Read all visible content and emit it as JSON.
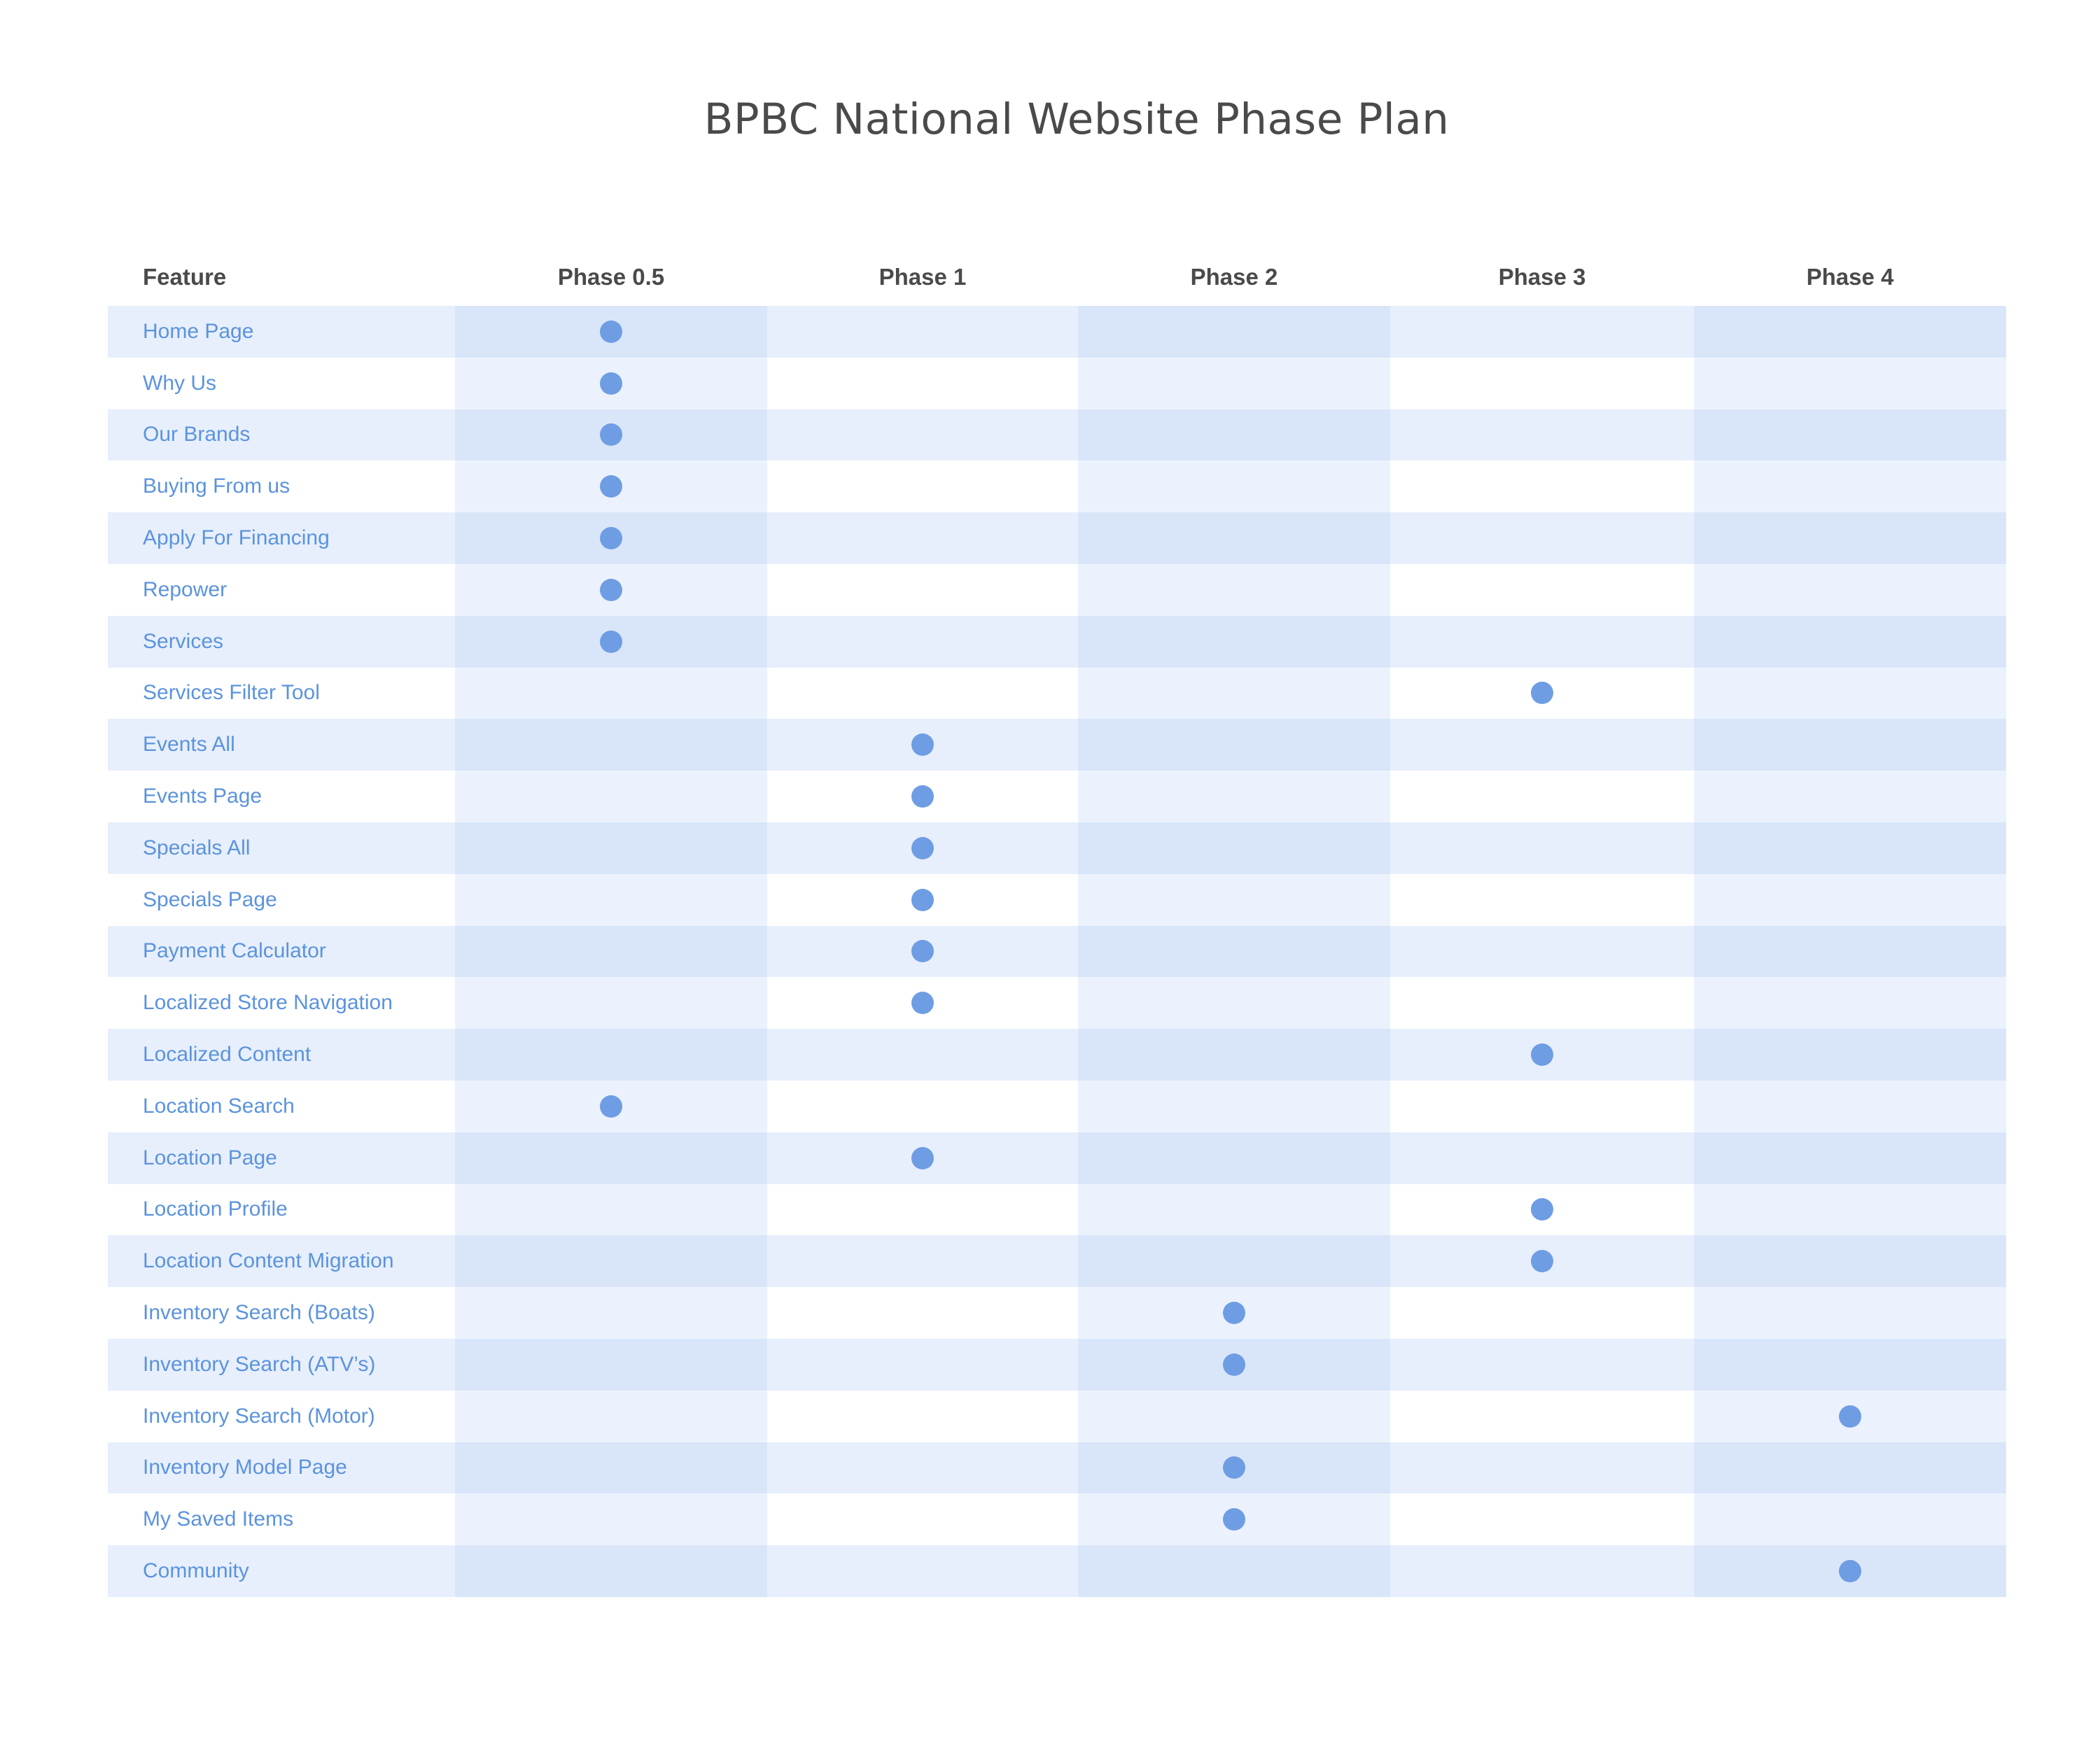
{
  "title": "BPBC National Website Phase Plan",
  "colors": {
    "title": "#4a4a4a",
    "header": "#4a4a4a",
    "feature_text": "#5b93dd",
    "dot": "#6e9de4",
    "band_dark": "#d9e6f9",
    "band_light": "#e7effc",
    "band_dark_alt": "#ebf2fd",
    "row_white": "#ffffff"
  },
  "columns": [
    "Feature",
    "Phase 0.5",
    "Phase 1",
    "Phase 2",
    "Phase 3",
    "Phase 4"
  ],
  "phases": [
    "Phase 0.5",
    "Phase 1",
    "Phase 2",
    "Phase 3",
    "Phase 4"
  ],
  "marker_icon": "filled-circle-icon",
  "rows": [
    {
      "feature": "Home Page",
      "phase": "Phase 0.5"
    },
    {
      "feature": "Why Us",
      "phase": "Phase 0.5"
    },
    {
      "feature": "Our Brands",
      "phase": "Phase 0.5"
    },
    {
      "feature": "Buying From us",
      "phase": "Phase 0.5"
    },
    {
      "feature": "Apply For Financing",
      "phase": "Phase 0.5"
    },
    {
      "feature": "Repower",
      "phase": "Phase 0.5"
    },
    {
      "feature": "Services",
      "phase": "Phase 0.5"
    },
    {
      "feature": "Services Filter Tool",
      "phase": "Phase 3"
    },
    {
      "feature": "Events All",
      "phase": "Phase 1"
    },
    {
      "feature": "Events Page",
      "phase": "Phase 1"
    },
    {
      "feature": "Specials All",
      "phase": "Phase 1"
    },
    {
      "feature": "Specials Page",
      "phase": "Phase 1"
    },
    {
      "feature": "Payment Calculator",
      "phase": "Phase 1"
    },
    {
      "feature": "Localized Store Navigation",
      "phase": "Phase 1"
    },
    {
      "feature": "Localized Content",
      "phase": "Phase 3"
    },
    {
      "feature": "Location Search",
      "phase": "Phase 0.5"
    },
    {
      "feature": "Location Page",
      "phase": "Phase 1"
    },
    {
      "feature": "Location Profile",
      "phase": "Phase 3"
    },
    {
      "feature": "Location Content Migration",
      "phase": "Phase 3"
    },
    {
      "feature": "Inventory Search (Boats)",
      "phase": "Phase 2"
    },
    {
      "feature": "Inventory Search (ATV’s)",
      "phase": "Phase 2"
    },
    {
      "feature": "Inventory Search (Motor)",
      "phase": "Phase 4"
    },
    {
      "feature": "Inventory Model Page",
      "phase": "Phase 2"
    },
    {
      "feature": "My Saved Items",
      "phase": "Phase 2"
    },
    {
      "feature": "Community",
      "phase": "Phase 4"
    }
  ]
}
